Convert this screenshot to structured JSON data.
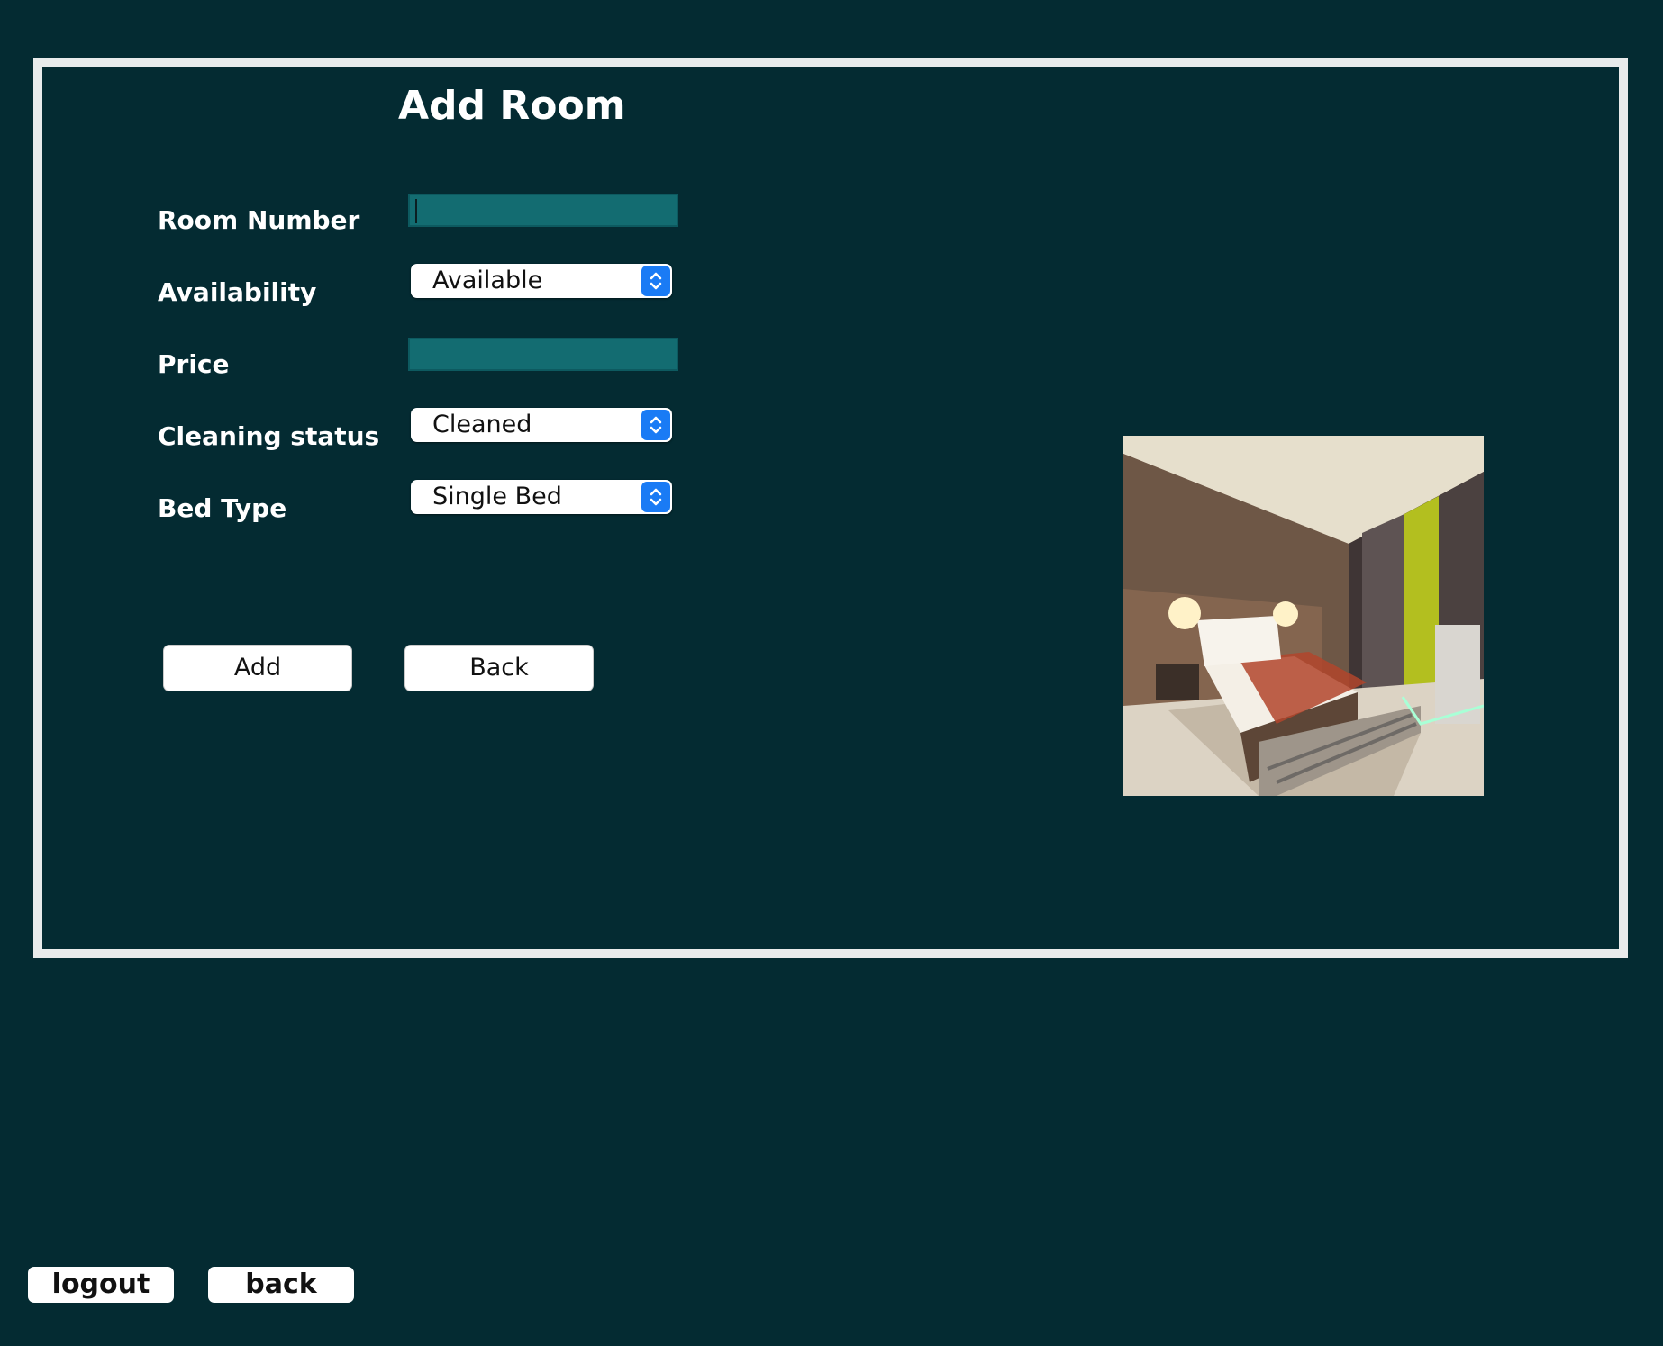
{
  "form": {
    "title": "Add Room",
    "room_number": {
      "label": "Room Number",
      "value": ""
    },
    "availability": {
      "label": "Availability",
      "selected": "Available"
    },
    "price": {
      "label": "Price",
      "value": ""
    },
    "cleaning_status": {
      "label": "Cleaning status",
      "selected": "Cleaned"
    },
    "bed_type": {
      "label": "Bed Type",
      "selected": "Single Bed"
    },
    "add_label": "Add",
    "back_label": "Back"
  },
  "image": {
    "subject": "hotel room with bed"
  },
  "footer": {
    "logout_label": "logout",
    "back_label": "back"
  },
  "colors": {
    "background": "#042b32",
    "panel_border": "#e9ebeb",
    "input_fill": "#136c71",
    "select_arrow": "#1a7bf5",
    "text_light": "#ffffff"
  },
  "icons": {
    "select_arrow": "chevron-up-down-icon"
  }
}
